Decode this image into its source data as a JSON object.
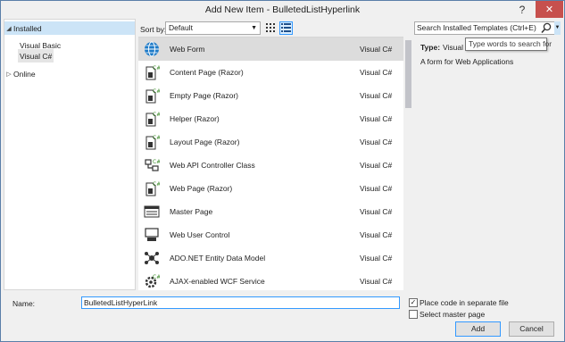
{
  "window": {
    "title": "Add New Item - BulletedListHyperlink",
    "help_label": "?",
    "close_label": "✕"
  },
  "tree": {
    "items": [
      {
        "label": "Installed",
        "expanded": true,
        "selected": true
      },
      {
        "label": "Visual Basic"
      },
      {
        "label": "Visual C#"
      },
      {
        "label": "Online",
        "expanded": false
      }
    ]
  },
  "toolbar": {
    "sort_label": "Sort by:",
    "sort_value": "Default"
  },
  "templates": [
    {
      "name": "Web Form",
      "lang": "Visual C#",
      "icon": "globe-icon",
      "selected": true
    },
    {
      "name": "Content Page (Razor)",
      "lang": "Visual C#",
      "icon": "razor-page-icon"
    },
    {
      "name": "Empty Page (Razor)",
      "lang": "Visual C#",
      "icon": "razor-page-icon"
    },
    {
      "name": "Helper (Razor)",
      "lang": "Visual C#",
      "icon": "razor-page-icon"
    },
    {
      "name": "Layout Page (Razor)",
      "lang": "Visual C#",
      "icon": "razor-page-icon"
    },
    {
      "name": "Web API Controller Class",
      "lang": "Visual C#",
      "icon": "controller-icon"
    },
    {
      "name": "Web Page (Razor)",
      "lang": "Visual C#",
      "icon": "razor-page-icon"
    },
    {
      "name": "Master Page",
      "lang": "Visual C#",
      "icon": "master-page-icon"
    },
    {
      "name": "Web User Control",
      "lang": "Visual C#",
      "icon": "user-control-icon"
    },
    {
      "name": "ADO.NET Entity Data Model",
      "lang": "Visual C#",
      "icon": "entity-model-icon"
    },
    {
      "name": "AJAX-enabled WCF Service",
      "lang": "Visual C#",
      "icon": "wcf-service-icon"
    }
  ],
  "details": {
    "search_placeholder": "Search Installed Templates (Ctrl+E)",
    "type_label": "Type:",
    "type_value": "Visual",
    "description": "A form for Web Applications",
    "tooltip": "Type words to search for"
  },
  "bottom": {
    "name_label": "Name:",
    "name_value": "BulletedListHyperLink",
    "place_code_label": "Place code in separate file",
    "place_code_checked": true,
    "master_page_label": "Select master page",
    "master_page_checked": false,
    "add_label": "Add",
    "cancel_label": "Cancel"
  }
}
